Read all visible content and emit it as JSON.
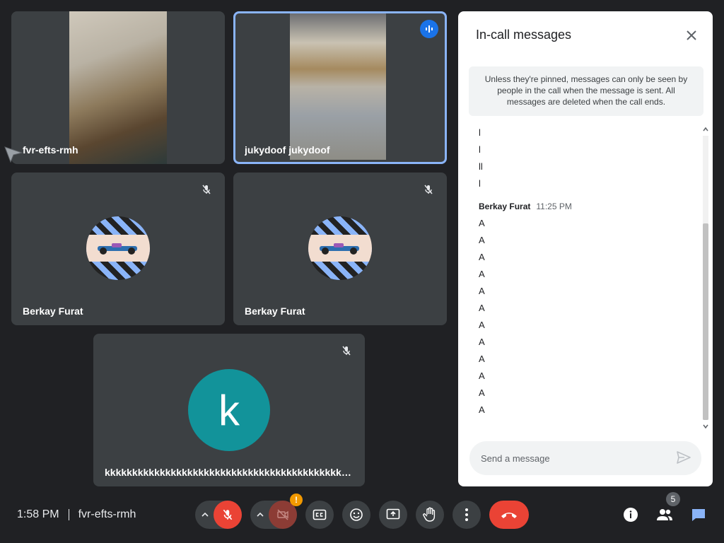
{
  "tiles": [
    {
      "name": "fvr-efts-rmh"
    },
    {
      "name": "jukydoof jukydoof"
    },
    {
      "name": "Berkay Furat"
    },
    {
      "name": "Berkay Furat"
    },
    {
      "name": "kkkkkkkkkkkkkkkkkkkkkkkkkkkkkkkkkkkkkkkkkkkkk...",
      "initial": "k"
    }
  ],
  "panel": {
    "title": "In-call messages",
    "notice": "Unless they're pinned, messages can only be seen by people in the call when the message is sent. All messages are deleted when the call ends.",
    "early_lines": [
      "l",
      "l",
      "ll",
      "l"
    ],
    "sender": "Berkay Furat",
    "time": "11:25 PM",
    "lines": [
      "A",
      "A",
      "A",
      "A",
      "A",
      "A",
      "A",
      "A",
      "A",
      "A",
      "A",
      "A"
    ],
    "composer_placeholder": "Send a message"
  },
  "bottom": {
    "time": "1:58 PM",
    "meeting_code": "fvr-efts-rmh",
    "camera_warning": "!",
    "people_count": "5"
  },
  "colors": {
    "background": "#202124",
    "tile": "#3c4043",
    "danger": "#ea4335",
    "accent": "#8ab4f8",
    "chat_icon": "#8ab4f8"
  }
}
